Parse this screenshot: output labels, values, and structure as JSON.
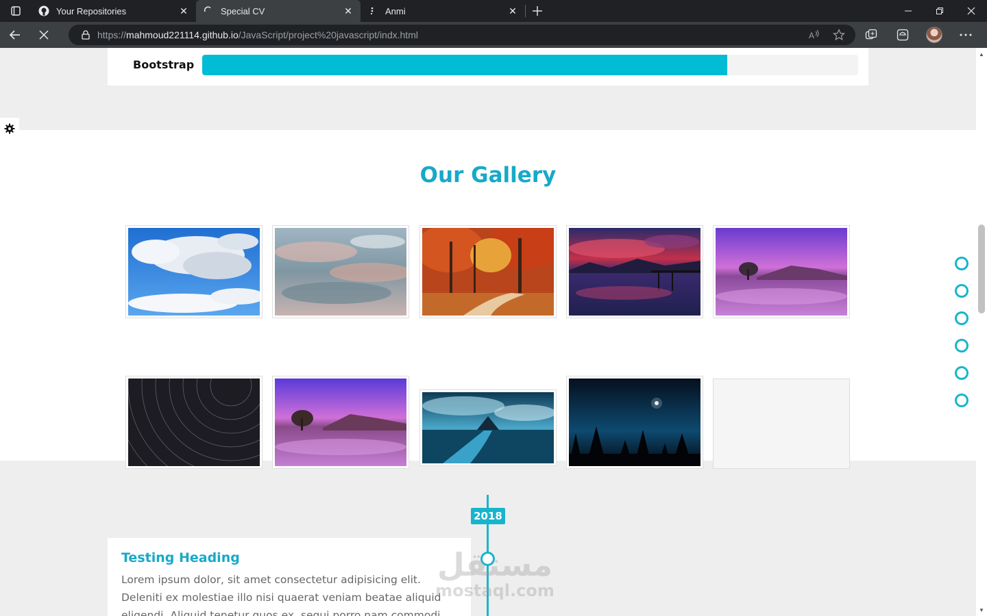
{
  "browser": {
    "tabs": [
      {
        "label": "Your Repositories",
        "icon": "github-icon",
        "active": false
      },
      {
        "label": "Special CV",
        "icon": "loading-spinner-icon",
        "active": true
      },
      {
        "label": "Anmi",
        "icon": "dots-icon",
        "active": false
      }
    ],
    "url_scheme": "https://",
    "url_host": "mahmoud221114.github.io",
    "url_path": "/JavaScript/project%20javascript/indx.html"
  },
  "skills": {
    "name": "Bootstrap",
    "percent": 80
  },
  "gallery": {
    "title": "Our Gallery",
    "images": [
      {
        "name": "clouds-blue-sky"
      },
      {
        "name": "pastel-cloudy-sky"
      },
      {
        "name": "autumn-forest-path"
      },
      {
        "name": "sunset-lake-pier"
      },
      {
        "name": "purple-lake-tree"
      },
      {
        "name": "star-trails-night"
      },
      {
        "name": "purple-lake-tree-2"
      },
      {
        "name": "river-to-mountain-castle"
      },
      {
        "name": "night-forest-moon"
      },
      {
        "name": "empty-placeholder"
      }
    ]
  },
  "nav_bullets": 6,
  "timeline": {
    "year": "2018",
    "heading": "Testing Heading",
    "text": "Lorem ipsum dolor, sit amet consectetur adipisicing elit. Deleniti ex molestiae illo nisi quaerat veniam beatae aliquid eligendi. Aliquid tenetur quos ex, sequi porro nam commodi placeat."
  },
  "watermark": {
    "arabic": "مستقل",
    "latin": "mostaql.com"
  },
  "colors": {
    "accent": "#17b5cd",
    "progress": "#00bcd4"
  }
}
